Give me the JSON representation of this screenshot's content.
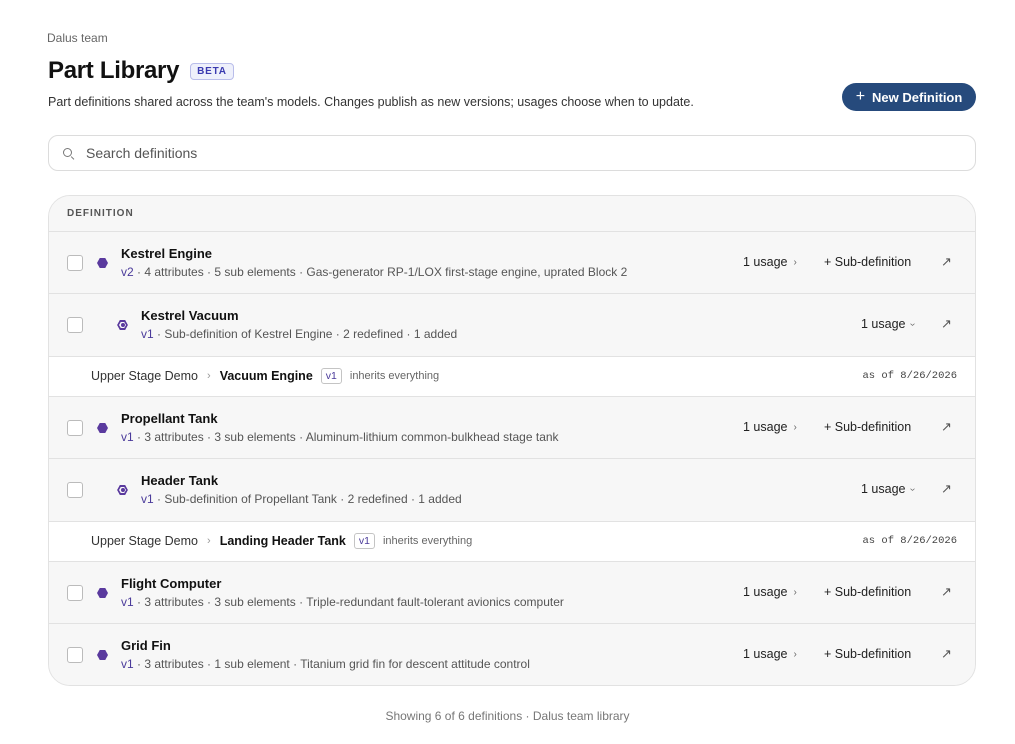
{
  "header": {
    "team": "Dalus team",
    "title": "Part Library",
    "badge": "BETA",
    "subtitle": "Part definitions shared across the team's models. Changes publish as new versions; usages choose when to update.",
    "new_button_icon": "+",
    "new_button_label": "New Definition"
  },
  "search": {
    "placeholder": "Search definitions"
  },
  "table": {
    "column_header": "DEFINITION",
    "rows": [
      {
        "name": "Kestrel Engine",
        "version": "v2",
        "meta": " · 4 attributes · 5 sub elements · Gas-generator RP-1/LOX first-stage engine, uprated Block 2",
        "usage": "1 usage",
        "subdef": "+ Sub-definition"
      },
      {
        "name": "Kestrel Vacuum",
        "version": "v1",
        "meta": " · Sub-definition of Kestrel Engine · 2 redefined · 1 added",
        "usage": "1 usage"
      },
      {
        "model": "Upper Stage Demo",
        "usage_name": "Vacuum Engine",
        "version": "v1",
        "note": "inherits everything",
        "as_of": "as of 8/26/2026"
      },
      {
        "name": "Propellant Tank",
        "version": "v1",
        "meta": " · 3 attributes · 3 sub elements · Aluminum-lithium common-bulkhead stage tank",
        "usage": "1 usage",
        "subdef": "+ Sub-definition"
      },
      {
        "name": "Header Tank",
        "version": "v1",
        "meta": " · Sub-definition of Propellant Tank · 2 redefined · 1 added",
        "usage": "1 usage"
      },
      {
        "model": "Upper Stage Demo",
        "usage_name": "Landing Header Tank",
        "version": "v1",
        "note": "inherits everything",
        "as_of": "as of 8/26/2026"
      },
      {
        "name": "Flight Computer",
        "version": "v1",
        "meta": " · 3 attributes · 3 sub elements · Triple-redundant fault-tolerant avionics computer",
        "usage": "1 usage",
        "subdef": "+ Sub-definition"
      },
      {
        "name": "Grid Fin",
        "version": "v1",
        "meta": " · 3 attributes · 1 sub element · Titanium grid fin for descent attitude control",
        "usage": "1 usage",
        "subdef": "+ Sub-definition"
      }
    ]
  },
  "icons": {
    "open": "↗",
    "chevron": "›",
    "crumb_sep": "›"
  },
  "colors": {
    "primary_button": "#264a7c",
    "part_icon": "#5a3a9e",
    "version_text": "#4a3a9a"
  },
  "footer": {
    "text": "Showing 6 of 6 definitions · Dalus team library"
  }
}
